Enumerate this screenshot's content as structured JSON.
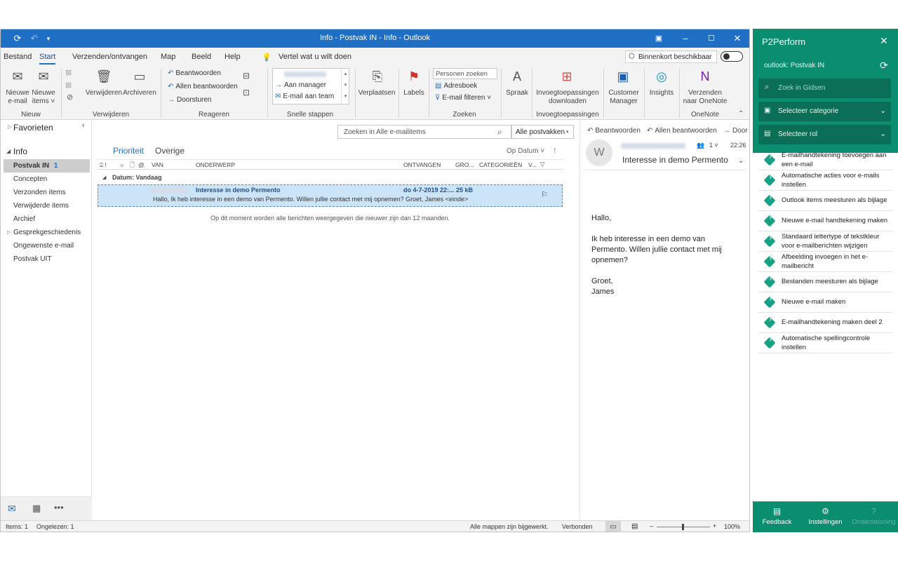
{
  "window": {
    "title": "Info - Postvak IN - Info  -  Outlook"
  },
  "menu": {
    "items": [
      "Bestand",
      "Start",
      "Verzenden/ontvangen",
      "Map",
      "Beeld",
      "Help"
    ],
    "tellme": "Vertel wat u wilt doen",
    "coming_soon": "Binnenkort beschikbaar"
  },
  "ribbon": {
    "new_email": "Nieuwe\ne-mail",
    "new_items": "Nieuwe\nitems ˅",
    "group_new": "Nieuw",
    "delete": "Verwijderen",
    "archive": "Archiveren",
    "group_delete": "Verwijderen",
    "reply": "Beantwoorden",
    "reply_all": "Allen beantwoorden",
    "forward": "Doorsturen",
    "group_respond": "Reageren",
    "qs_manager": "Aan manager",
    "qs_team": "E-mail aan team",
    "group_quicksteps": "Snelle stappen",
    "move": "Verplaatsen",
    "labels": "Labels",
    "search_people": "Personen zoeken",
    "addressbook": "Adresboek",
    "filter_email": "E-mail filteren ˅",
    "group_find": "Zoeken",
    "speech": "Spraak",
    "get_addins": "Invoegtoepassingen\ndownloaden",
    "group_addins": "Invoegtoepassingen",
    "customer_manager": "Customer\nManager",
    "insights": "Insights",
    "onenote": "Verzenden\nnaar OneNote",
    "group_onenote": "OneNote"
  },
  "nav": {
    "favorites": "Favorieten",
    "account": "Info",
    "folders": [
      {
        "name": "Postvak IN",
        "count": "1"
      },
      {
        "name": "Concepten",
        "count": ""
      },
      {
        "name": "Verzonden items",
        "count": ""
      },
      {
        "name": "Verwijderde items",
        "count": ""
      },
      {
        "name": "Archief",
        "count": ""
      },
      {
        "name": "Gesprekgeschiedenis",
        "count": ""
      },
      {
        "name": "Ongewenste e-mail",
        "count": ""
      },
      {
        "name": "Postvak UIT",
        "count": ""
      }
    ]
  },
  "list": {
    "search_placeholder": "Zoeken in Alle e-mailitems",
    "scope": "Alle postvakken",
    "tab_focused": "Prioriteit",
    "tab_other": "Overige",
    "sort": "Op Datum ˅",
    "columns": [
      "VAN",
      "ONDERWERP",
      "ONTVANGEN",
      "GRO...",
      "CATEGORIEËN",
      "V..."
    ],
    "group_header": "Datum: Vandaag",
    "messages": [
      {
        "subject": "Interesse in demo Permento",
        "received": "do 4-7-2019 22:...",
        "size": "25 kB",
        "preview": "Hallo,  Ik heb interesse in een demo van Permento. Willen jullie contact met mij opnemen?  Groet,  James <einde>"
      }
    ],
    "notice": "Op dit moment worden alle berichten weergegeven die nieuwer zijn dan 12 maanden."
  },
  "reading": {
    "reply": "Beantwoorden",
    "reply_all": "Allen beantwoorden",
    "forward": "Door",
    "avatar": "W",
    "people_count": "1 ˅",
    "time": "22:26",
    "subject": "Interesse in demo Permento",
    "body": [
      "Hallo,",
      "Ik heb interesse in een demo van Permento. Willen jullie contact met mij opnemen?",
      "Groet,\nJames"
    ]
  },
  "status": {
    "items": "Items: 1",
    "unread": "Ongelezen: 1",
    "sync": "Alle mappen zijn bijgewerkt.",
    "connection": "Verbonden",
    "zoom": "100%"
  },
  "p2": {
    "title": "P2Perform",
    "context": "outlook: Postvak IN",
    "search_placeholder": "Zoek in Gidsen",
    "select_category": "Selecteer categorie",
    "select_role": "Selecteer rol",
    "guides": [
      "E-mailhandtekening toevoegen aan een e-mail",
      "Automatische acties voor e-mails instellen",
      "Outlook items meesturen als bijlage",
      "Nieuwe e-mail handtekening maken",
      "Standaard lettertype of tekstkleur voor e-mailberichten wijzigen",
      "Afbeelding invoegen in het e-mailbericht",
      "Bestanden meesturen als bijlage",
      "Nieuwe e-mail maken",
      "E-mailhandtekening maken deel 2",
      "Automatische spellingcontrole instellen"
    ],
    "footer": [
      "Feedback",
      "Instellingen",
      "Ondersteuning"
    ]
  },
  "colors": {
    "outlook_blue": "#1f6fc5",
    "p2_green": "#0b8d6f",
    "selection": "#cce4f7"
  }
}
